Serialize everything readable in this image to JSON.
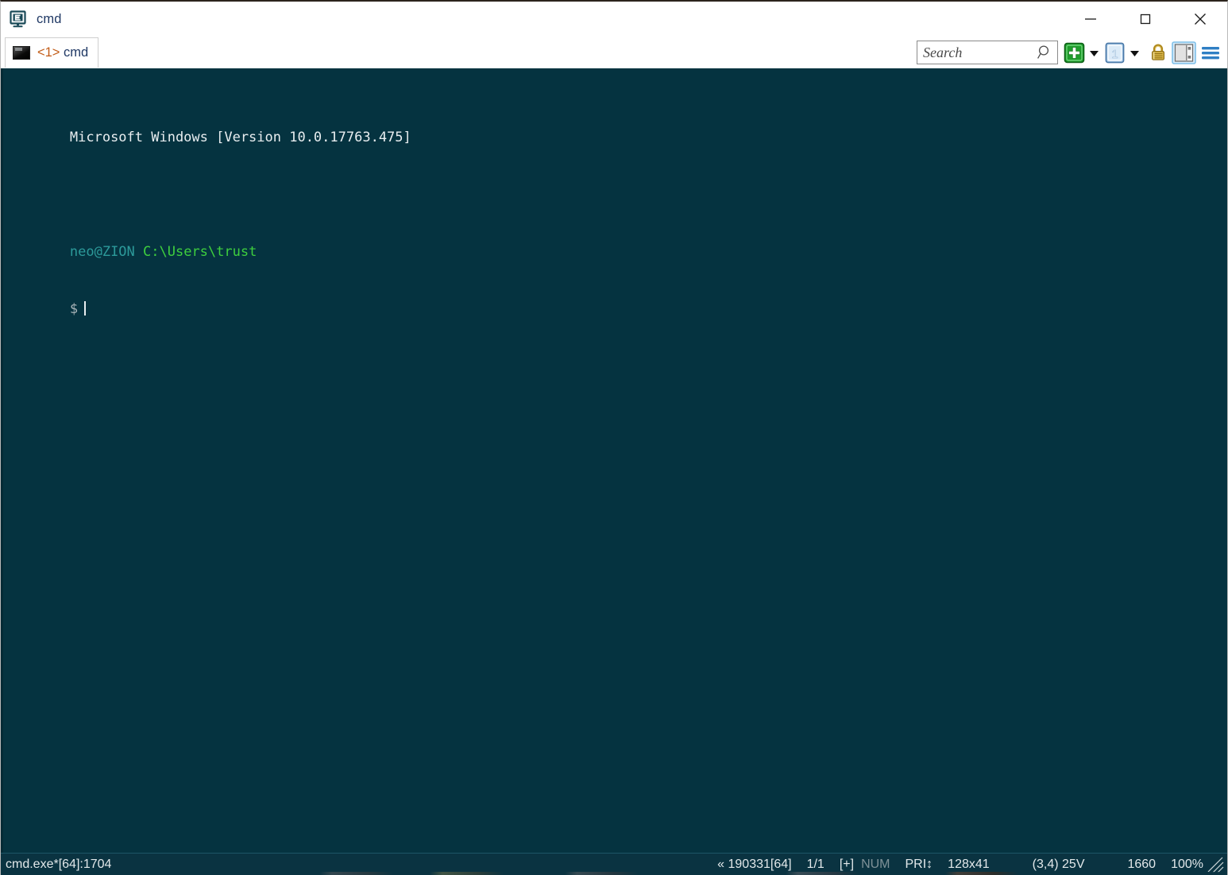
{
  "window": {
    "title": "cmd",
    "app_icon": "conemu-icon",
    "controls": {
      "minimize": "minimize-icon",
      "maximize": "maximize-icon",
      "close": "close-icon"
    }
  },
  "tabs": [
    {
      "index": "<1>",
      "label": "cmd",
      "icon": "console-icon",
      "active": true
    }
  ],
  "toolbar": {
    "search": {
      "placeholder": "Search",
      "value": "",
      "icon": "search-icon"
    },
    "new_console": {
      "label": "+",
      "icon": "plus-icon",
      "tooltip": "New console"
    },
    "new_console_dropdown": {
      "icon": "chevron-down-icon"
    },
    "active_console": {
      "label": "1",
      "icon": "console-number-icon"
    },
    "active_console_dropdown": {
      "icon": "chevron-down-icon"
    },
    "lock": {
      "icon": "lock-icon"
    },
    "panel_toggle": {
      "icon": "panel-layout-icon",
      "active": true
    },
    "menu": {
      "icon": "hamburger-menu-icon"
    }
  },
  "terminal": {
    "background": "#053340",
    "lines": [
      {
        "segments": [
          {
            "text": "Microsoft Windows [Version 10.0.17763.475]",
            "color": "white"
          }
        ]
      },
      {
        "segments": []
      },
      {
        "segments": [
          {
            "text": "neo@ZION",
            "color": "teal"
          },
          {
            "text": " ",
            "color": "white"
          },
          {
            "text": "C:\\Users\\trust",
            "color": "green"
          }
        ]
      },
      {
        "segments": [
          {
            "text": "$",
            "color": "gray"
          }
        ],
        "cursor": true
      }
    ],
    "colors": {
      "white": "#e9eef0",
      "teal": "#2c9a9a",
      "green": "#3ecf3e",
      "gray": "#a9b4b8"
    }
  },
  "statusbar": {
    "left": "cmd.exe*[64]:1704",
    "items": [
      {
        "name": "build",
        "text": "« 190331[64]",
        "dim": false
      },
      {
        "name": "console-count",
        "text": "1/1",
        "dim": false
      },
      {
        "name": "expand-flag",
        "text": "[+]",
        "dim": false
      },
      {
        "name": "num-lock",
        "text": "NUM",
        "dim": true
      },
      {
        "name": "priority",
        "text": "PRI↕",
        "dim": false
      },
      {
        "name": "buffer-size",
        "text": "128x41",
        "dim": false
      },
      {
        "name": "cursor-position",
        "text": "(3,4) 25V",
        "dim": false
      },
      {
        "name": "memory",
        "text": "1660",
        "dim": false
      },
      {
        "name": "zoom-level",
        "text": "100%",
        "dim": false
      }
    ],
    "grip": "resize-grip-icon"
  }
}
